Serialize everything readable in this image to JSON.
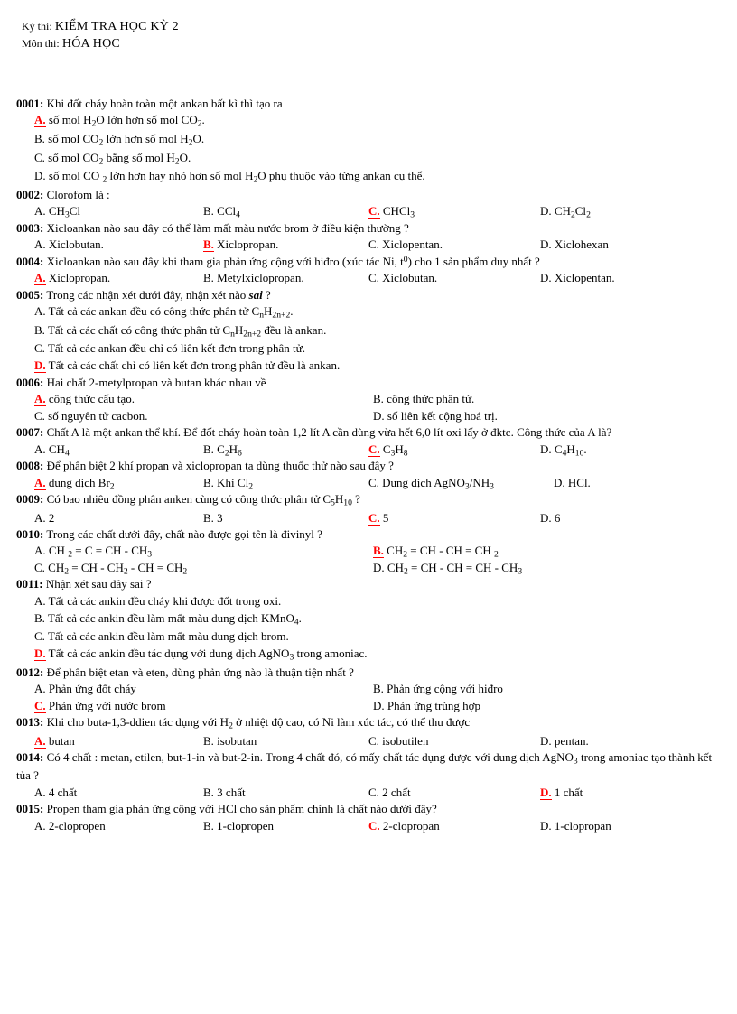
{
  "header": {
    "exam_label": "Kỳ thi:",
    "exam_value": "KIỂM TRA HỌC KỲ 2",
    "subject_label": "Môn thi:",
    "subject_value": "HÓA HỌC"
  },
  "colors": {
    "correct_answer": "#ff0000",
    "text": "#000000",
    "page_background": "#ffffff"
  },
  "questions": [
    {
      "number": "0001:",
      "stem": "Khi đốt cháy hoàn toàn một ankan bất kì thì tạo ra",
      "layout": "stacked",
      "correct": "A",
      "options": [
        {
          "letter": "A.",
          "text_html": "số mol H<sub>2</sub>O lớn hơn số mol CO<sub>2</sub>."
        },
        {
          "letter": "B.",
          "text_html": "số mol CO<sub>2</sub> lớn hơn số mol H<sub>2</sub>O."
        },
        {
          "letter": "C.",
          "text_html": "số mol CO<sub>2</sub> bằng số mol H<sub>2</sub>O."
        },
        {
          "letter": "D.",
          "text_html": "số mol CO <sub>2</sub> lớn hơn hay nhỏ hơn số mol H<sub>2</sub>O phụ thuộc vào từng ankan cụ thể."
        }
      ]
    },
    {
      "number": "0002:",
      "stem": "Clorofom là :",
      "layout": "four",
      "correct": "C",
      "options": [
        {
          "letter": "A.",
          "text_html": "CH<sub>3</sub>Cl"
        },
        {
          "letter": "B.",
          "text_html": "CCl<sub>4</sub>"
        },
        {
          "letter": "C.",
          "text_html": "CHCl<sub>3</sub>"
        },
        {
          "letter": "D.",
          "text_html": "CH<sub>2</sub>Cl<sub>2</sub>"
        }
      ]
    },
    {
      "number": "0003:",
      "stem": "Xicloankan  nào sau đây có thể làm mất màu nước brom ở điều kiện thường ?",
      "layout": "four",
      "correct": "B",
      "options": [
        {
          "letter": "A.",
          "text_html": "Xiclobutan."
        },
        {
          "letter": "B.",
          "text_html": "Xiclopropan."
        },
        {
          "letter": "C.",
          "text_html": "Xiclopentan."
        },
        {
          "letter": "D.",
          "text_html": "Xiclohexan"
        }
      ]
    },
    {
      "number": "0004:",
      "stem_html": "Xicloankan  nào sau đây khi tham gia phản ứng cộng với hiđro (xúc tác Ni, t<sup>0</sup>) cho 1 sản phẩm duy nhất ?",
      "stem": "Xicloankan  nào sau đây khi tham gia phản ứng cộng với hiđro (xúc tác Ni, t0) cho 1 sản phẩm duy nhất ?",
      "layout": "four",
      "correct": "A",
      "options": [
        {
          "letter": "A.",
          "text_html": "Xiclopropan."
        },
        {
          "letter": "B.",
          "text_html": "Metylxiclopropan."
        },
        {
          "letter": "C.",
          "text_html": "Xiclobutan."
        },
        {
          "letter": "D.",
          "text_html": "Xiclopentan."
        }
      ]
    },
    {
      "number": "0005:",
      "stem_html": "Trong các nhận xét dưới đây, nhận xét nào <span class=\"ital\">sai</span> ?",
      "stem": "Trong các nhận xét dưới đây, nhận xét nào sai ?",
      "layout": "stacked",
      "correct": "D",
      "options": [
        {
          "letter": "A.",
          "text_html": "Tất cả các ankan đều có công thức phân tử C<sub>n</sub>H<sub>2n+2</sub>."
        },
        {
          "letter": "B.",
          "text_html": "Tất cả các chất có công thức phân tử C<sub>n</sub>H<sub>2n+2</sub> đều là ankan."
        },
        {
          "letter": "C.",
          "text_html": "Tất cả các ankan đều chỉ có liên kết đơn trong phân tử."
        },
        {
          "letter": "D.",
          "text_html": "Tất cả các chất chỉ có liên kết đơn trong phân tử đều là ankan."
        }
      ]
    },
    {
      "number": "0006:",
      "stem": "Hai chất 2-metylpropan và butan khác nhau về",
      "layout": "two",
      "correct": "A",
      "options": [
        {
          "letter": "A.",
          "text_html": "công thức cấu tạo."
        },
        {
          "letter": "B.",
          "text_html": "công thức phân tử."
        },
        {
          "letter": "C.",
          "text_html": "số nguyên tử cacbon."
        },
        {
          "letter": "D.",
          "text_html": "số liên kết cộng hoá trị."
        }
      ]
    },
    {
      "number": "0007:",
      "stem": "Chất A là một ankan thể khí. Để đốt cháy hoàn toàn 1,2 lít A cần dùng vừa hết 6,0 lít oxi lấy ở đktc. Công thức của A là?",
      "layout": "four",
      "correct": "C",
      "options": [
        {
          "letter": "A.",
          "text_html": "CH<sub>4</sub>"
        },
        {
          "letter": "B.",
          "text_html": "C<sub>2</sub>H<sub>6</sub>"
        },
        {
          "letter": "C.",
          "text_html": "C<sub>3</sub>H<sub>8</sub>"
        },
        {
          "letter": "D.",
          "text_html": "C<sub>4</sub>H<sub>10</sub>."
        }
      ]
    },
    {
      "number": "0008:",
      "stem": "Để phân biệt 2 khí propan và xiclopropan  ta dùng thuốc  thử nào sau đây ?",
      "layout": "four_tight",
      "correct": "A",
      "options": [
        {
          "letter": "A.",
          "text_html": "dung dịch Br<sub>2</sub>"
        },
        {
          "letter": "B.",
          "text_html": "Khí Cl<sub>2</sub>"
        },
        {
          "letter": "C.",
          "text_html": "Dung dịch AgNO<sub>3</sub>/NH<sub>3</sub>"
        },
        {
          "letter": "D.",
          "text_html": "HCl."
        }
      ]
    },
    {
      "number": "0009:",
      "stem_html": "Có bao nhiêu đồng phân anken cùng có công thức phân tử C<sub>5</sub>H<sub>10</sub> ?",
      "stem": "Có bao nhiêu đồng phân anken cùng có công thức phân tử C5H10 ?",
      "layout": "four",
      "correct": "C",
      "options": [
        {
          "letter": "A.",
          "text_html": "2"
        },
        {
          "letter": "B.",
          "text_html": "3"
        },
        {
          "letter": "C.",
          "text_html": "5"
        },
        {
          "letter": "D.",
          "text_html": "6"
        }
      ]
    },
    {
      "number": "0010:",
      "stem": "Trong các chất dưới đây, chất nào được gọi tên là đivinyl  ?",
      "layout": "two",
      "correct": "B",
      "options": [
        {
          "letter": "A.",
          "text_html": "CH <sub>2</sub> = C = CH - CH<sub>3</sub>"
        },
        {
          "letter": "B.",
          "text_html": "CH<sub>2</sub> = CH - CH = CH  <sub>2</sub>"
        },
        {
          "letter": "C.",
          "text_html": "CH<sub>2</sub> = CH - CH<sub>2</sub> - CH = CH<sub>2</sub>"
        },
        {
          "letter": "D.",
          "text_html": "CH<sub>2</sub> = CH - CH = CH - CH<sub>3</sub>"
        }
      ]
    },
    {
      "number": "0011:",
      "stem": "Nhận xét sau đây sai ?",
      "layout": "stacked",
      "correct": "D",
      "options": [
        {
          "letter": "A.",
          "text_html": "Tất cả các ankin đều cháy khi được đốt trong oxi."
        },
        {
          "letter": "B.",
          "text_html": "Tất cả các ankin đều làm mất màu dung dịch KMnO<sub>4</sub>."
        },
        {
          "letter": "C.",
          "text_html": "Tất cả các ankin đều làm mất màu dung dịch brom."
        },
        {
          "letter": "D.",
          "text_html": "Tất cả các ankin đều tác dụng với dung dịch AgNO<sub>3</sub> trong amoniac."
        }
      ]
    },
    {
      "number": "0012:",
      "stem": "Để phân biệt etan và eten, dùng phản ứng nào là thuận tiện nhất ?",
      "layout": "two",
      "correct": "C",
      "options": [
        {
          "letter": "A.",
          "text_html": "Phản ứng đốt cháy"
        },
        {
          "letter": "B.",
          "text_html": "Phản ứng cộng với hiđro"
        },
        {
          "letter": "C.",
          "text_html": "Phản ứng với nước brom"
        },
        {
          "letter": "D.",
          "text_html": "Phản ứng trùng hợp"
        }
      ]
    },
    {
      "number": "0013:",
      "stem_html": "Khi cho buta-1,3-ddien tác dụng với H<sub>2</sub> ở nhiệt độ cao, có Ni làm xúc tác, có thể thu được",
      "stem": "Khi cho buta-1,3-ddien tác dụng với H2 ở nhiệt độ cao, có Ni làm xúc tác, có thể thu được",
      "layout": "four",
      "correct": "A",
      "options": [
        {
          "letter": "A.",
          "text_html": "butan"
        },
        {
          "letter": "B.",
          "text_html": "isobutan"
        },
        {
          "letter": "C.",
          "text_html": "isobutilen"
        },
        {
          "letter": "D.",
          "text_html": "pentan."
        }
      ]
    },
    {
      "number": "0014:",
      "stem_html": "Có 4 chất : metan, etilen,  but-1-in và but-2-in. Trong 4 chất đó, có mấy chất tác dụng được với dung dịch AgNO<sub>3</sub> trong amoniac  tạo thành  kết tủa ?",
      "stem": "Có 4 chất : metan, etilen, but-1-in và but-2-in. Trong 4 chất đó, có mấy chất tác dụng được với dung dịch AgNO3 trong amoniac tạo thành kết tủa ?",
      "layout": "four",
      "correct": "D",
      "options": [
        {
          "letter": "A.",
          "text_html": "4 chất"
        },
        {
          "letter": "B.",
          "text_html": "3 chất"
        },
        {
          "letter": "C.",
          "text_html": "2 chất"
        },
        {
          "letter": "D.",
          "text_html": "1 chất"
        }
      ]
    },
    {
      "number": "0015:",
      "stem": "Propen tham gia phản ứng cộng với HCl cho sản phẩm chính  là chất nào dưới đây?",
      "layout": "four",
      "correct": "C",
      "options": [
        {
          "letter": "A.",
          "text_html": "2-clopropen"
        },
        {
          "letter": "B.",
          "text_html": "1-clopropen"
        },
        {
          "letter": "C.",
          "text_html": "2-clopropan"
        },
        {
          "letter": "D.",
          "text_html": "1-clopropan"
        }
      ]
    }
  ]
}
